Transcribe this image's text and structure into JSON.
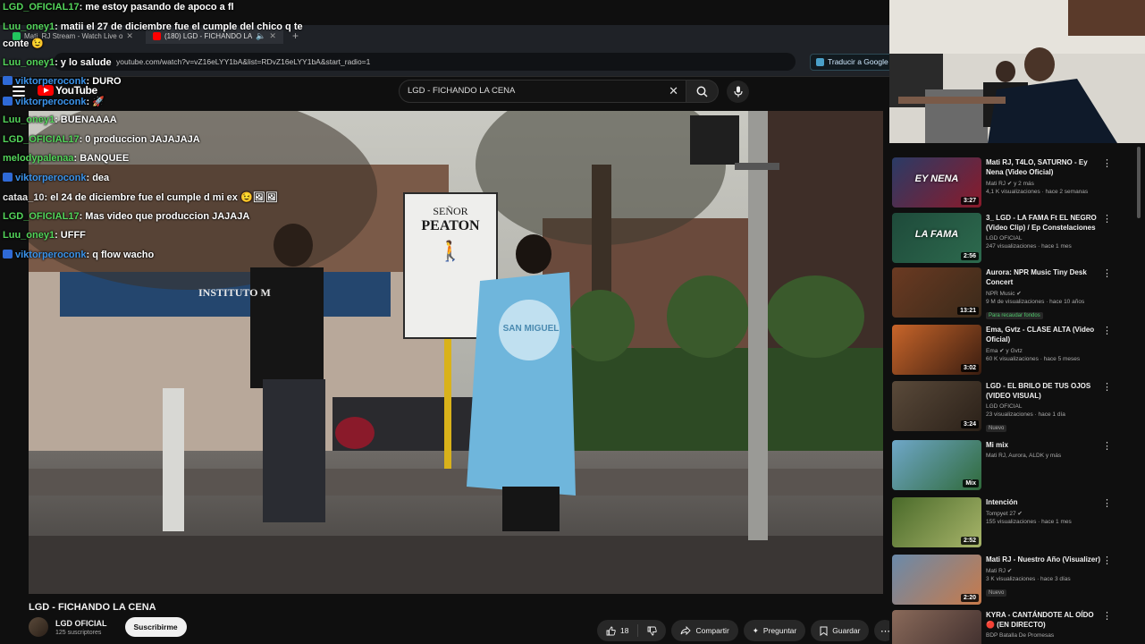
{
  "browser": {
    "tabs": [
      {
        "label": "Mati_RJ Stream - Watch Live o",
        "active": false,
        "color": "#22c55e"
      },
      {
        "label": "(180) LGD - FICHANDO LA",
        "active": true,
        "color": "#ff0000"
      }
    ],
    "url": "youtube.com/watch?v=vZ16eLYY1bA&list=RDvZ16eLYY1bA&start_radio=1",
    "translate_label": "Traducir a Google"
  },
  "youtube": {
    "logo": "YouTube",
    "search_value": "LGD - FICHANDO LA CENA"
  },
  "video": {
    "sign_line1": "SEÑOR",
    "sign_line2": "PEATON",
    "building_sign": "INSTITUTO M",
    "flag_text": "SAN MIGUEL",
    "title": "LGD - FICHANDO LA CENA",
    "channel": "LGD OFICIAL",
    "subscribers": "125 suscriptores",
    "subscribe_label": "Suscribirme",
    "likes": "18",
    "share_label": "Compartir",
    "ask_label": "Preguntar",
    "save_label": "Guardar"
  },
  "chat": [
    {
      "user": "LGD_OFICIAL17",
      "color": "green",
      "badge": false,
      "text": ": me estoy pasando de apoco a fl"
    },
    {
      "user": "Luu_oney1",
      "color": "green",
      "badge": false,
      "text": ": matii el 27 de diciembre fue el cumple del chico q te"
    },
    {
      "user": "",
      "color": "gray",
      "badge": false,
      "text": "conte 😉"
    },
    {
      "user": "Luu_oney1",
      "color": "green",
      "badge": false,
      "text": ": y lo salude"
    },
    {
      "user": "viktorperoconk",
      "color": "blue",
      "badge": true,
      "text": ": DURO"
    },
    {
      "user": "viktorperoconk",
      "color": "blue",
      "badge": true,
      "text": ": 🚀"
    },
    {
      "user": "Luu_oney1",
      "color": "green",
      "badge": false,
      "text": ": BUENAAAA"
    },
    {
      "user": "LGD_OFICIAL17",
      "color": "green",
      "badge": false,
      "text": ": 0 produccion JAJAJAJA"
    },
    {
      "user": "melodypalenaa",
      "color": "green",
      "badge": false,
      "text": ": BANQUEE"
    },
    {
      "user": "viktorperoconk",
      "color": "blue",
      "badge": true,
      "text": ": dea"
    },
    {
      "user": "cataa_10",
      "color": "gray",
      "badge": false,
      "text": ": el 24 de diciembre fue el cumple d mi ex 😉🖼🖼"
    },
    {
      "user": "LGD_OFICIAL17",
      "color": "green",
      "badge": false,
      "text": ": Mas video que produccion JAJAJA"
    },
    {
      "user": "Luu_oney1",
      "color": "green",
      "badge": false,
      "text": ": UFFF"
    },
    {
      "user": "viktorperoconk",
      "color": "blue",
      "badge": true,
      "text": ": q flow wacho"
    }
  ],
  "sidebar": [
    {
      "title": "Mati RJ, T4LO, SATURNO - Ey Nena (Video Oficial)",
      "channel": "Mati RJ ✔ y 2 más",
      "stats": "4,1 K visualizaciones · hace 2 semanas",
      "duration": "3:27",
      "tag": "",
      "thumb_text": "EY NENA",
      "c1": "#2a3b66",
      "c2": "#8b1a2a"
    },
    {
      "title": "3_ LGD - LA FAMA Ft EL NEGRO (Video Clip) / Ep Constelaciones",
      "channel": "LGD OFICIAL",
      "stats": "247 visualizaciones · hace 1 mes",
      "duration": "2:56",
      "tag": "",
      "thumb_text": "LA FAMA",
      "c1": "#1e4a3a",
      "c2": "#2d6a4e"
    },
    {
      "title": "Aurora: NPR Music Tiny Desk Concert",
      "channel": "NPR Music ✔",
      "stats": "9 M de visualizaciones · hace 10 años",
      "duration": "13:21",
      "tag": "Para recaudar fondos",
      "thumb_text": "",
      "c1": "#6b3a22",
      "c2": "#3a2a1a"
    },
    {
      "title": "Ema, Gvtz - CLASE ALTA (Video Oficial)",
      "channel": "Ema ✔ y Gvtz",
      "stats": "60 K visualizaciones · hace 5 meses",
      "duration": "3:02",
      "tag": "",
      "thumb_text": "",
      "c1": "#c8652a",
      "c2": "#3a1d10"
    },
    {
      "title": "LGD - EL BRILO DE TUS OJOS (VIDEO VISUAL)",
      "channel": "LGD OFICIAL",
      "stats": "23 visualizaciones · hace 1 día",
      "duration": "3:24",
      "tag": "Nuevo",
      "thumb_text": "",
      "c1": "#5a4a3a",
      "c2": "#2a2018"
    },
    {
      "title": "Mi mix",
      "channel": "Mati RJ, Aurora, ALDK y más",
      "stats": "",
      "duration": "Mix",
      "tag": "",
      "thumb_text": "",
      "c1": "#6fa7c9",
      "c2": "#2f6a3a"
    },
    {
      "title": "Intención",
      "channel": "Tompyet 27 ✔",
      "stats": "155 visualizaciones · hace 1 mes",
      "duration": "2:52",
      "tag": "",
      "thumb_text": "",
      "c1": "#4a6a2a",
      "c2": "#a8b56a"
    },
    {
      "title": "Mati RJ - Nuestro Año (Visualizer)",
      "channel": "Mati RJ ✔",
      "stats": "3 K visualizaciones · hace 3 días",
      "duration": "2:20",
      "tag": "Nuevo",
      "thumb_text": "",
      "c1": "#6a8aaa",
      "c2": "#c87a4a"
    },
    {
      "title": "KYRA - CANTÁNDOTE AL OÍDO 🔴 (EN DIRECTO)",
      "channel": "BDP Batalla De Promesas",
      "stats": "",
      "duration": "",
      "tag": "",
      "thumb_text": "",
      "c1": "#8a6a5a",
      "c2": "#3a2a2a"
    }
  ]
}
